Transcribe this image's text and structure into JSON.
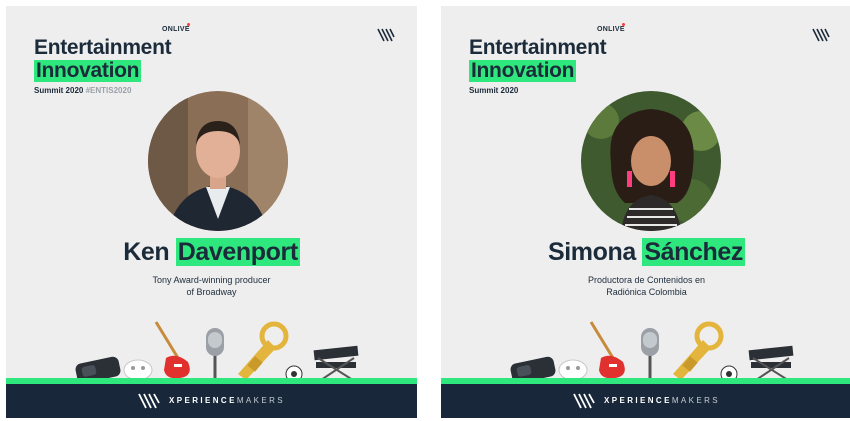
{
  "cards": [
    {
      "online": "ONLIVE",
      "title_line1": "Entertainment",
      "title_line2": "Innovation",
      "summit": "Summit 2020",
      "hashtag": "#ENTIS2020",
      "first_name": "Ken",
      "last_name": "Davenport",
      "role_line1": "Tony Award-winning producer",
      "role_line2": "of Broadway",
      "footer_bold": "XPERIENCE",
      "footer_thin": "MAKERS"
    },
    {
      "online": "ONLIVE",
      "title_line1": "Entertainment",
      "title_line2": "Innovation",
      "summit": "Summit 2020",
      "first_name": "Simona",
      "last_name": "Sánchez",
      "role_line1": "Productora de Contenidos en",
      "role_line2": "Radiónica Colombia",
      "footer_bold": "XPERIENCE",
      "footer_thin": "MAKERS"
    }
  ],
  "colors": {
    "accent_green": "#2ee87e",
    "navy": "#1c2b3a",
    "footer_navy": "#18283a",
    "card_bg": "#eeeeee"
  },
  "icons": [
    "xm-logo-icon",
    "vr-headset-icon",
    "theater-mask-icon",
    "electric-guitar-icon",
    "microphone-icon",
    "trumpet-icon",
    "soccer-ball-icon",
    "director-chair-icon"
  ]
}
